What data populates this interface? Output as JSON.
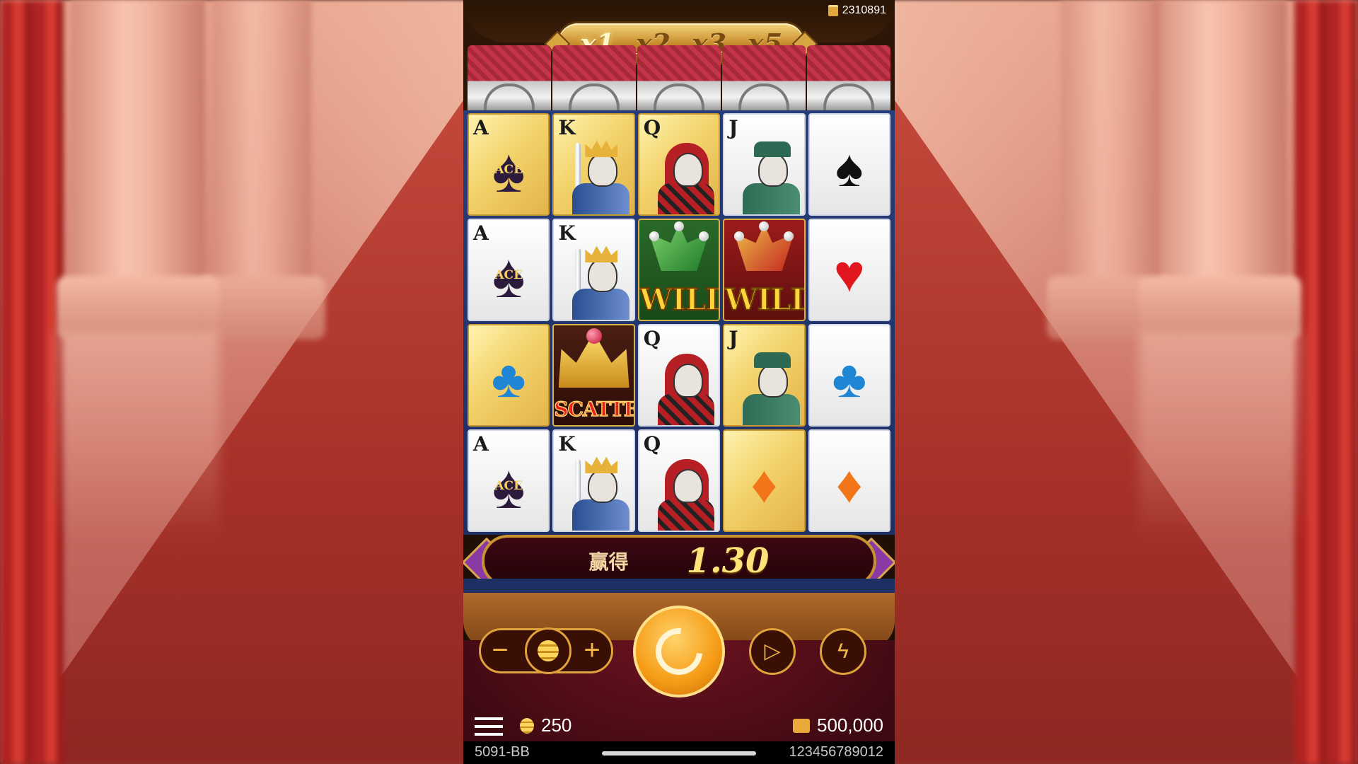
{
  "header": {
    "balance_code": "2310891",
    "multipliers": [
      "x1",
      "x2",
      "x3",
      "x5"
    ],
    "active_multiplier": "x1"
  },
  "grid": [
    [
      {
        "rank": "A",
        "symbol": "ace-spade",
        "label": "ACE",
        "gold": true
      },
      {
        "rank": "K",
        "symbol": "king",
        "gold": true
      },
      {
        "rank": "Q",
        "symbol": "queen",
        "gold": true
      },
      {
        "rank": "J",
        "symbol": "jack",
        "gold": false
      },
      {
        "rank": "",
        "symbol": "spade",
        "gold": false
      }
    ],
    [
      {
        "rank": "A",
        "symbol": "ace-spade",
        "label": "ACE",
        "gold": false
      },
      {
        "rank": "K",
        "symbol": "king",
        "gold": false
      },
      {
        "rank": "",
        "symbol": "wild",
        "label": "WILD",
        "variant": "green"
      },
      {
        "rank": "",
        "symbol": "wild",
        "label": "WILD",
        "variant": "red"
      },
      {
        "rank": "",
        "symbol": "heart",
        "gold": false
      }
    ],
    [
      {
        "rank": "",
        "symbol": "club",
        "gold": true
      },
      {
        "rank": "",
        "symbol": "scatter",
        "label": "SCATTER"
      },
      {
        "rank": "Q",
        "symbol": "queen",
        "gold": false
      },
      {
        "rank": "J",
        "symbol": "jack",
        "gold": true
      },
      {
        "rank": "",
        "symbol": "club",
        "gold": false
      }
    ],
    [
      {
        "rank": "A",
        "symbol": "ace-spade",
        "label": "ACE",
        "gold": false
      },
      {
        "rank": "K",
        "symbol": "king",
        "gold": false
      },
      {
        "rank": "Q",
        "symbol": "queen",
        "gold": false
      },
      {
        "rank": "",
        "symbol": "diamond",
        "gold": true
      },
      {
        "rank": "",
        "symbol": "diamond",
        "gold": false
      }
    ]
  ],
  "win": {
    "label": "赢得",
    "value": "1.30"
  },
  "controls": {
    "minus": "−",
    "plus": "+",
    "play_icon": "play-icon",
    "turbo_icon": "lightning-icon",
    "spin_icon": "spin-arrow-icon"
  },
  "footer": {
    "bet": "250",
    "balance": "500,000",
    "game_id": "5091-BB",
    "player_id": "123456789012"
  },
  "colors": {
    "board_blue": "#273c7a",
    "gold": "#e0a23a",
    "spin_orange": "#f59b16",
    "heart_red": "#e1161e",
    "club_blue": "#1f86d6",
    "diamond_orange": "#f2751a"
  }
}
